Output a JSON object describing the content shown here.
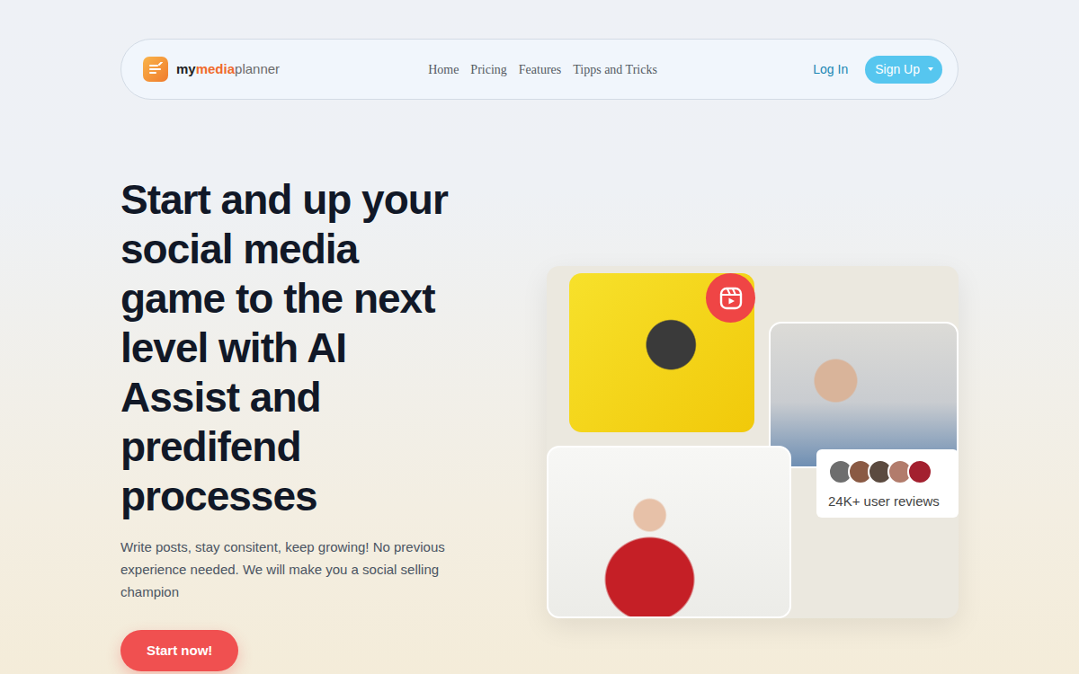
{
  "brand": {
    "parts": [
      {
        "text": "my",
        "kind": "dark"
      },
      {
        "text": "media",
        "kind": "accent"
      },
      {
        "text": "planner",
        "kind": "light"
      }
    ]
  },
  "nav": {
    "links": [
      "Home",
      "Pricing",
      "Features",
      "Tipps and Tricks"
    ]
  },
  "auth": {
    "login": "Log In",
    "signup": "Sign Up"
  },
  "hero": {
    "title": "Start and up your social media game to the next level with AI Assist and predifend processes",
    "subtitle": "Write posts, stay consitent, keep growing! No previous experience needed. We will make you a social selling champion",
    "cta": "Start now!"
  },
  "reviews": {
    "label": "24K+ user reviews",
    "avatars": [
      {
        "color": "#6e6e6e"
      },
      {
        "color": "#8a5a44"
      },
      {
        "color": "#5b4a3f"
      },
      {
        "color": "#b27c6c"
      },
      {
        "color": "#a3202f"
      }
    ]
  }
}
